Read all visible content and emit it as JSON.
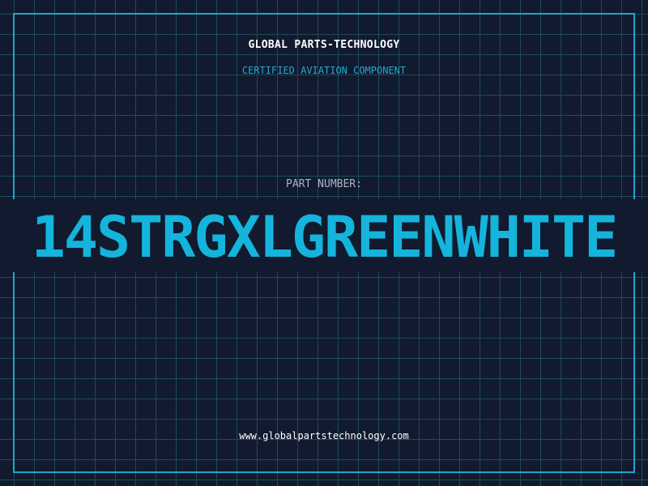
{
  "header": {
    "company": "GLOBAL PARTS-TECHNOLOGY",
    "tagline": "CERTIFIED AVIATION COMPONENT"
  },
  "part": {
    "label": "PART NUMBER:",
    "number": "14STRGXLGREENWHITE"
  },
  "footer": {
    "url": "www.globalpartstechnology.com"
  },
  "colors": {
    "background": "#111a2e",
    "grid": "#1f4a5c",
    "accent": "#14b4dc",
    "frame": "#1ea6cf"
  }
}
